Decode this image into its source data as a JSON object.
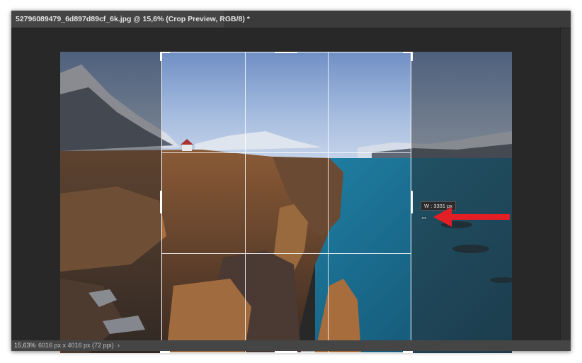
{
  "document_tab": {
    "title": "52796089479_6d897d89cf_6k.jpg @ 15,6% (Crop Preview, RGB/8) *",
    "close_glyph": "×"
  },
  "crop_tooltip": "W : 3331 px",
  "status_bar": {
    "zoom": "15,63%",
    "doc_info": "6016 px x 4016 px (72 ppi)",
    "expand_glyph": "›"
  },
  "icons": {
    "resize_cursor": "horizontal-resize-icon",
    "annotation_arrow": "red-arrow-icon"
  },
  "colors": {
    "annotation_arrow": "#e31e24",
    "crop_border": "#ffffff"
  }
}
